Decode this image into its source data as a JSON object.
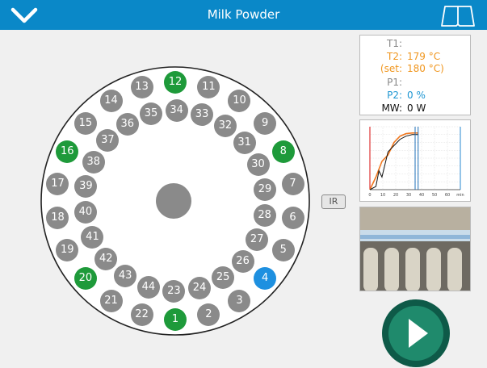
{
  "header": {
    "title": "Milk Powder",
    "menu_icon": "chevron-down-icon",
    "manual_icon": "book-icon"
  },
  "carousel": {
    "outer_positions": [
      {
        "label": "1",
        "state": "green"
      },
      {
        "label": "2",
        "state": "grey"
      },
      {
        "label": "3",
        "state": "grey"
      },
      {
        "label": "4",
        "state": "blue"
      },
      {
        "label": "5",
        "state": "grey"
      },
      {
        "label": "6",
        "state": "grey"
      },
      {
        "label": "7",
        "state": "grey"
      },
      {
        "label": "8",
        "state": "green"
      },
      {
        "label": "9",
        "state": "grey"
      },
      {
        "label": "10",
        "state": "grey"
      },
      {
        "label": "11",
        "state": "grey"
      },
      {
        "label": "12",
        "state": "green"
      },
      {
        "label": "13",
        "state": "grey"
      },
      {
        "label": "14",
        "state": "grey"
      },
      {
        "label": "15",
        "state": "grey"
      },
      {
        "label": "16",
        "state": "green"
      },
      {
        "label": "17",
        "state": "grey"
      },
      {
        "label": "18",
        "state": "grey"
      },
      {
        "label": "19",
        "state": "grey"
      },
      {
        "label": "20",
        "state": "green"
      },
      {
        "label": "21",
        "state": "grey"
      },
      {
        "label": "22",
        "state": "grey"
      }
    ],
    "inner_positions": [
      {
        "label": "23",
        "state": "grey"
      },
      {
        "label": "24",
        "state": "grey"
      },
      {
        "label": "25",
        "state": "grey"
      },
      {
        "label": "26",
        "state": "grey"
      },
      {
        "label": "27",
        "state": "grey"
      },
      {
        "label": "28",
        "state": "grey"
      },
      {
        "label": "29",
        "state": "grey"
      },
      {
        "label": "30",
        "state": "grey"
      },
      {
        "label": "31",
        "state": "grey"
      },
      {
        "label": "32",
        "state": "grey"
      },
      {
        "label": "33",
        "state": "grey"
      },
      {
        "label": "34",
        "state": "grey"
      },
      {
        "label": "35",
        "state": "grey"
      },
      {
        "label": "36",
        "state": "grey"
      },
      {
        "label": "37",
        "state": "grey"
      },
      {
        "label": "38",
        "state": "grey"
      },
      {
        "label": "39",
        "state": "grey"
      },
      {
        "label": "40",
        "state": "grey"
      },
      {
        "label": "41",
        "state": "grey"
      },
      {
        "label": "42",
        "state": "grey"
      },
      {
        "label": "43",
        "state": "grey"
      },
      {
        "label": "44",
        "state": "grey"
      }
    ],
    "ir_label": "IR"
  },
  "status": {
    "t1_label": "T1:",
    "t1_value": "",
    "t2_label": "T2:",
    "t2_value": "179 °C",
    "set_label": "(set:",
    "set_value": "180 °C)",
    "p1_label": "P1:",
    "p1_value": "",
    "p2_label": "P2:",
    "p2_value": "0 %",
    "mw_label": "MW:",
    "mw_value": "0 W"
  },
  "colors": {
    "header": "#0a88c8",
    "green": "#1e9a3a",
    "blue": "#1e90e0",
    "grey": "#8a8a8a",
    "orange": "#f0961e",
    "cyan": "#1e96d2",
    "play": "#1b7a63"
  },
  "chart_data": {
    "type": "line",
    "title": "",
    "xlabel": "",
    "ylabel": "",
    "x_ticks": [
      "0",
      "10",
      "20",
      "30",
      "40",
      "50",
      "60",
      "min"
    ],
    "series": [
      {
        "x": [
          0,
          4,
          8,
          12,
          16,
          20,
          24,
          28,
          32
        ],
        "y": [
          0,
          40,
          90,
          110,
          150,
          170,
          178,
          180,
          180
        ]
      },
      {
        "x": [
          0,
          4,
          6,
          8,
          12,
          16,
          20,
          24,
          28,
          32
        ],
        "y": [
          0,
          10,
          60,
          40,
          120,
          140,
          160,
          170,
          175,
          175
        ]
      }
    ]
  },
  "photo": {
    "description_icon": "sample-camera-image"
  },
  "actions": {
    "start_icon": "play-icon"
  }
}
